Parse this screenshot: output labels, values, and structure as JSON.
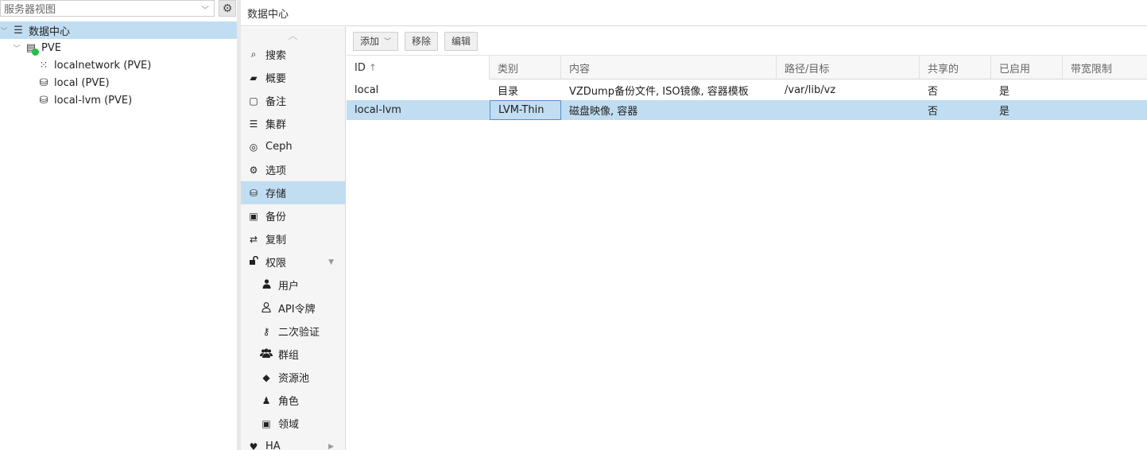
{
  "tree": {
    "view_select": "服务器视图",
    "nodes": [
      {
        "label": "数据中心",
        "icon": "datacenter-icon",
        "glyph": "☰"
      },
      {
        "label": "PVE",
        "icon": "server-online-icon",
        "glyph": "▤"
      },
      {
        "label": "localnetwork (PVE)",
        "icon": "network-grid-icon",
        "glyph": "⁙"
      },
      {
        "label": "local (PVE)",
        "icon": "storage-icon",
        "glyph": "⛁"
      },
      {
        "label": "local-lvm (PVE)",
        "icon": "storage-icon",
        "glyph": "⛁"
      }
    ]
  },
  "header": {
    "title": "数据中心"
  },
  "nav": {
    "items": [
      {
        "label": "搜索",
        "icon": "search-icon",
        "glyph": "⌕"
      },
      {
        "label": "概要",
        "icon": "book-icon",
        "glyph": "▰"
      },
      {
        "label": "备注",
        "icon": "note-icon",
        "glyph": "▢"
      },
      {
        "label": "集群",
        "icon": "cluster-icon",
        "glyph": "☰"
      },
      {
        "label": "Ceph",
        "icon": "ceph-icon",
        "glyph": "◎"
      },
      {
        "label": "选项",
        "icon": "gear-icon",
        "glyph": "⚙"
      },
      {
        "label": "存储",
        "icon": "database-icon",
        "glyph": "⛁"
      },
      {
        "label": "备份",
        "icon": "floppy-icon",
        "glyph": "▣"
      },
      {
        "label": "复制",
        "icon": "retweet-icon",
        "glyph": "⇄"
      },
      {
        "label": "权限",
        "icon": "unlock-icon",
        "glyph": "🔓"
      },
      {
        "label": "用户",
        "icon": "user-icon",
        "glyph": "●"
      },
      {
        "label": "API令牌",
        "icon": "user-outline-icon",
        "glyph": "○"
      },
      {
        "label": "二次验证",
        "icon": "key-icon",
        "glyph": "⚷"
      },
      {
        "label": "群组",
        "icon": "users-icon",
        "glyph": "☻"
      },
      {
        "label": "资源池",
        "icon": "tags-icon",
        "glyph": "◆"
      },
      {
        "label": "角色",
        "icon": "male-icon",
        "glyph": "♟"
      },
      {
        "label": "领域",
        "icon": "address-book-icon",
        "glyph": "▣"
      },
      {
        "label": "HA",
        "icon": "heartbeat-icon",
        "glyph": "♥"
      }
    ]
  },
  "toolbar": {
    "add": "添加",
    "remove": "移除",
    "edit": "编辑"
  },
  "grid": {
    "columns": [
      "ID",
      "类别",
      "内容",
      "路径/目标",
      "共享的",
      "已启用",
      "带宽限制"
    ],
    "sort_glyph": "↑",
    "rows": [
      {
        "id": "local",
        "type": "目录",
        "content": "VZDump备份文件, ISO镜像, 容器模板",
        "path": "/var/lib/vz",
        "shared": "否",
        "enabled": "是",
        "bw": ""
      },
      {
        "id": "local-lvm",
        "type": "LVM-Thin",
        "content": "磁盘映像, 容器",
        "path": "",
        "shared": "否",
        "enabled": "是",
        "bw": ""
      }
    ]
  },
  "colors": {
    "selection": "#c1ddf1",
    "status_ok": "#21bf4b"
  }
}
